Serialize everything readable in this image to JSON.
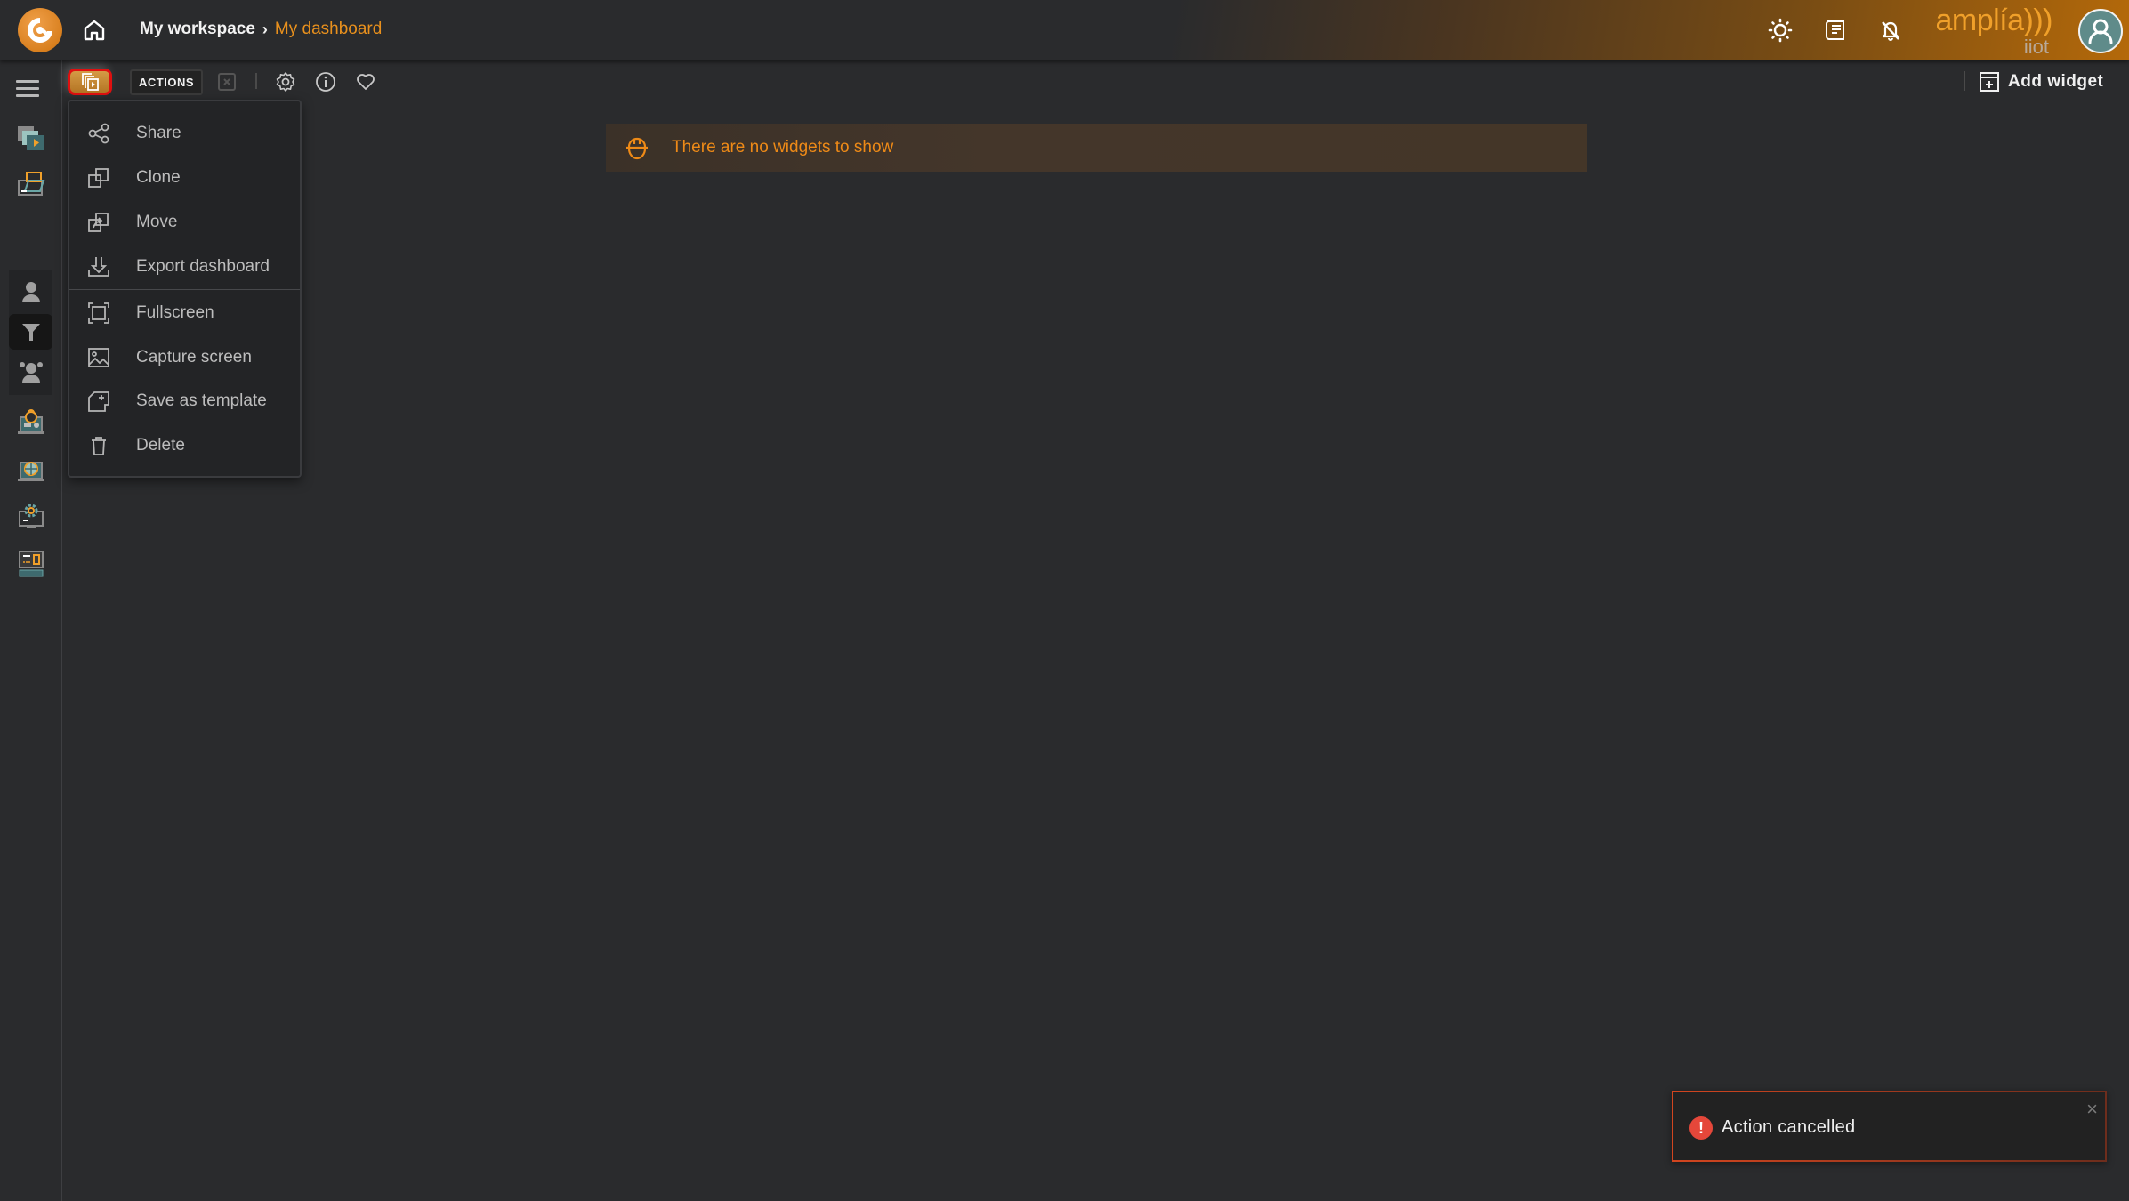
{
  "header": {
    "breadcrumb": {
      "root": "My workspace",
      "separator": "›",
      "current": "My dashboard"
    },
    "brand": {
      "main": "amplía)))",
      "sub": "iiot"
    },
    "icons": [
      "app-logo-icon",
      "home-icon",
      "theme-sun-icon",
      "release-notes-icon",
      "notifications-off-icon",
      "user-avatar-icon"
    ]
  },
  "sidebar": {
    "items": [
      {
        "name": "dashboards",
        "icon": "dashboards-icon"
      },
      {
        "name": "workspaces",
        "icon": "folder-monitor-icon"
      },
      {
        "name": "users",
        "icon": "user-icon"
      },
      {
        "name": "filters",
        "icon": "filter-icon",
        "active": true
      },
      {
        "name": "groups",
        "icon": "group-icon"
      },
      {
        "name": "security",
        "icon": "lock-monitor-icon"
      },
      {
        "name": "network",
        "icon": "globe-monitor-icon"
      },
      {
        "name": "settings",
        "icon": "gear-monitor-icon"
      },
      {
        "name": "devices",
        "icon": "device-monitor-icon"
      }
    ]
  },
  "toolbar": {
    "actions_label": "ACTIONS",
    "add_widget_label": "Add widget"
  },
  "dropdown": {
    "items": [
      {
        "label": "Share",
        "icon": "share-icon"
      },
      {
        "label": "Clone",
        "icon": "clone-icon"
      },
      {
        "label": "Move",
        "icon": "move-icon"
      },
      {
        "label": "Export dashboard",
        "icon": "export-icon"
      },
      {
        "label": "Fullscreen",
        "icon": "fullscreen-icon"
      },
      {
        "label": "Capture screen",
        "icon": "image-icon"
      },
      {
        "label": "Save as template",
        "icon": "save-template-icon"
      },
      {
        "label": "Delete",
        "icon": "trash-icon"
      }
    ]
  },
  "banner": {
    "text": "There are no widgets to show",
    "color": "#ee8a17"
  },
  "toast": {
    "text": "Action cancelled",
    "icon": "!",
    "close": "×",
    "color": "#e5473a"
  }
}
